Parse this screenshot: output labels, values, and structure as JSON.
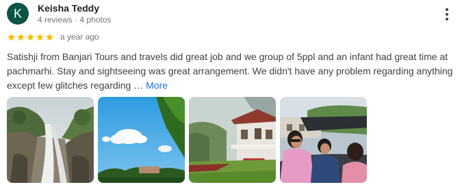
{
  "reviewer": {
    "initial": "K",
    "name": "Keisha Teddy",
    "meta": "4 reviews · 4 photos",
    "avatar_color": "#0b5345"
  },
  "rating": {
    "stars": 5,
    "star_color": "#fbbc04",
    "time": "a year ago"
  },
  "review": {
    "text": "Satishji from Banjari Tours and travels did great job and we group of 5ppl and an infant had great time at pachmarhi. Stay and sightseeing was great arrangement. We didn't have any problem regarding anything except few glitches regarding … ",
    "more_label": "More"
  },
  "menu": {
    "icon": "more-vert-icon"
  },
  "photos": [
    {
      "subject": "waterfall"
    },
    {
      "subject": "sky-trees"
    },
    {
      "subject": "house-garden"
    },
    {
      "subject": "people-car"
    }
  ]
}
